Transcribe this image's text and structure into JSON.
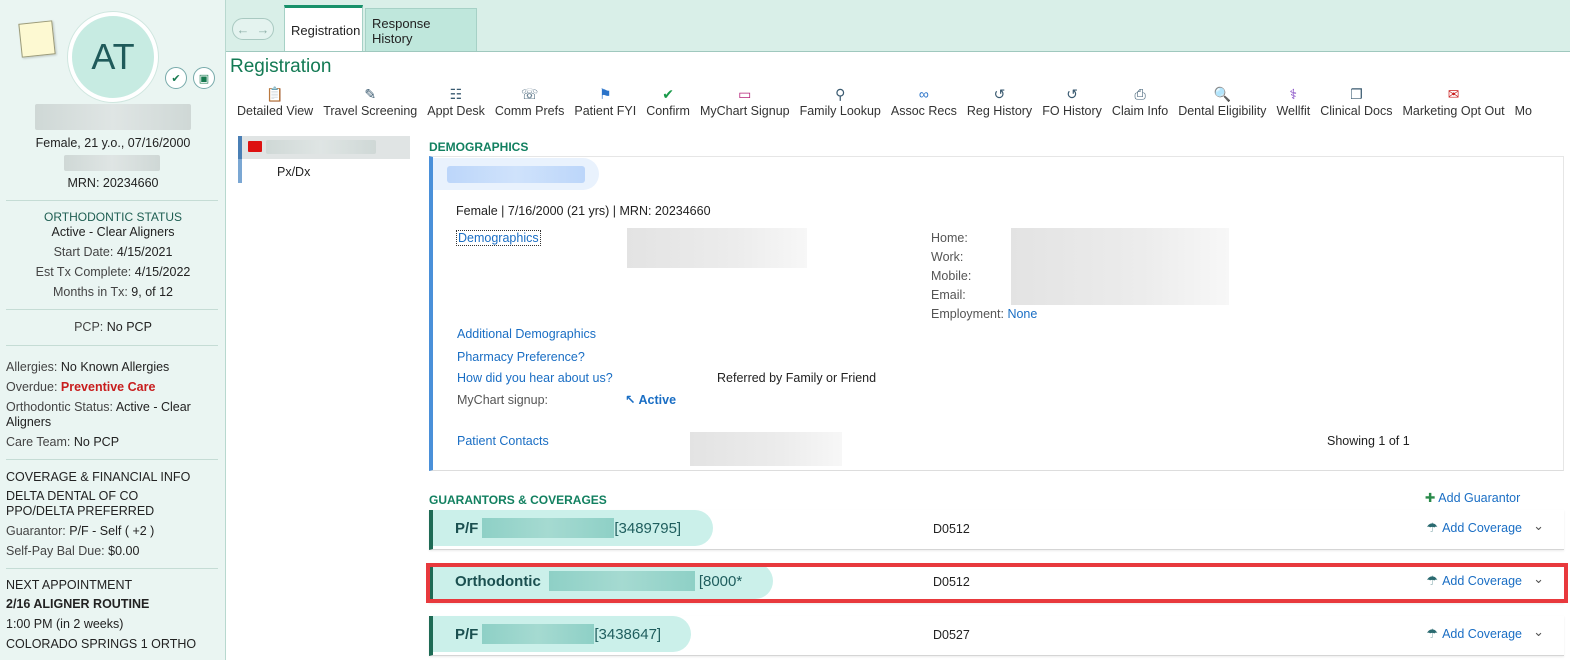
{
  "patient": {
    "initials": "AT",
    "summary": "Female, 21 y.o., 07/16/2000",
    "mrn": "MRN: 20234660"
  },
  "ortho": {
    "heading": "ORTHODONTIC STATUS",
    "status": "Active - Clear Aligners",
    "start_label": "Start Date:",
    "start_value": "4/15/2021",
    "est_label": "Est Tx Complete:",
    "est_value": "4/15/2022",
    "months_label": "Months in Tx:",
    "months_value": "9, of 12"
  },
  "pcp": {
    "label": "PCP:",
    "value": "No PCP"
  },
  "clinical": {
    "allergies_label": "Allergies:",
    "allergies_value": "No Known Allergies",
    "overdue_label": "Overdue:",
    "overdue_value": "Preventive Care",
    "ortho_label": "Orthodontic Status:",
    "ortho_value": "Active - Clear Aligners",
    "careteam_label": "Care Team:",
    "careteam_value": "No PCP"
  },
  "coverage_info": {
    "heading": "COVERAGE & FINANCIAL INFO",
    "plan": "DELTA DENTAL OF CO PPO/DELTA PREFERRED",
    "guarantor_label": "Guarantor:",
    "guarantor_value": "P/F - Self ( +2 )",
    "selfpay_label": "Self-Pay Bal Due:",
    "selfpay_value": "$0.00"
  },
  "next_appt": {
    "heading": "NEXT APPOINTMENT",
    "title": "2/16 ALIGNER ROUTINE",
    "time": "1:00 PM (in 2 weeks)",
    "location": "COLORADO SPRINGS 1 ORTHO"
  },
  "tabs": [
    {
      "label": "Registration",
      "active": true
    },
    {
      "label": "Response History",
      "active": false
    }
  ],
  "page_title": "Registration",
  "toolbar": [
    {
      "label": "Detailed View",
      "icon": "clipboard-icon"
    },
    {
      "label": "Travel Screening",
      "icon": "pencil-icon"
    },
    {
      "label": "Appt Desk",
      "icon": "hierarchy-icon"
    },
    {
      "label": "Comm Prefs",
      "icon": "phone-icon"
    },
    {
      "label": "Patient FYI",
      "icon": "flag-icon"
    },
    {
      "label": "Confirm",
      "icon": "check-icon"
    },
    {
      "label": "MyChart Signup",
      "icon": "mychart-icon"
    },
    {
      "label": "Family Lookup",
      "icon": "magnifier-icon"
    },
    {
      "label": "Assoc Recs",
      "icon": "link-icon"
    },
    {
      "label": "Reg History",
      "icon": "history-icon"
    },
    {
      "label": "FO History",
      "icon": "history-icon"
    },
    {
      "label": "Claim Info",
      "icon": "printer-icon"
    },
    {
      "label": "Dental Eligibility",
      "icon": "search-doc-icon"
    },
    {
      "label": "Wellfit",
      "icon": "wellfit-icon"
    },
    {
      "label": "Clinical Docs",
      "icon": "documents-icon"
    },
    {
      "label": "Marketing Opt Out",
      "icon": "no-mail-icon"
    },
    {
      "label": "Mo",
      "icon": "more-icon"
    }
  ],
  "leftnav": {
    "item": "Px/Dx"
  },
  "demographics": {
    "heading": "DEMOGRAPHICS",
    "summary": "Female | 7/16/2000 (21 yrs) | MRN: 20234660",
    "demographics_link": "Demographics",
    "home": "Home:",
    "work": "Work:",
    "mobile": "Mobile:",
    "email": "Email:",
    "employment_label": "Employment:",
    "employment_value": "None",
    "additional": "Additional Demographics",
    "pharmacy": "Pharmacy Preference?",
    "hear_label": "How did you hear about us?",
    "hear_value": "Referred by Family or Friend",
    "mychart_label": "MyChart signup:",
    "mychart_value": "Active",
    "contacts_link": "Patient Contacts",
    "showing": "Showing 1 of 1"
  },
  "guarantors": {
    "heading": "GUARANTORS & COVERAGES",
    "add_guarantor": "Add Guarantor",
    "rows": [
      {
        "prefix": "P/F",
        "id": "[3489795]",
        "code": "D0512",
        "action": "Add Coverage"
      },
      {
        "prefix": "Orthodontic",
        "id": "[8000*",
        "code": "D0512",
        "action": "Add Coverage"
      },
      {
        "prefix": "P/F",
        "id": "[3438647]",
        "code": "D0527",
        "action": "Add Coverage"
      }
    ]
  },
  "colors": {
    "accent_green": "#137a54",
    "link_blue": "#1a6ec4",
    "highlight_red": "#e8393d",
    "alert_red": "#c81d1d"
  }
}
